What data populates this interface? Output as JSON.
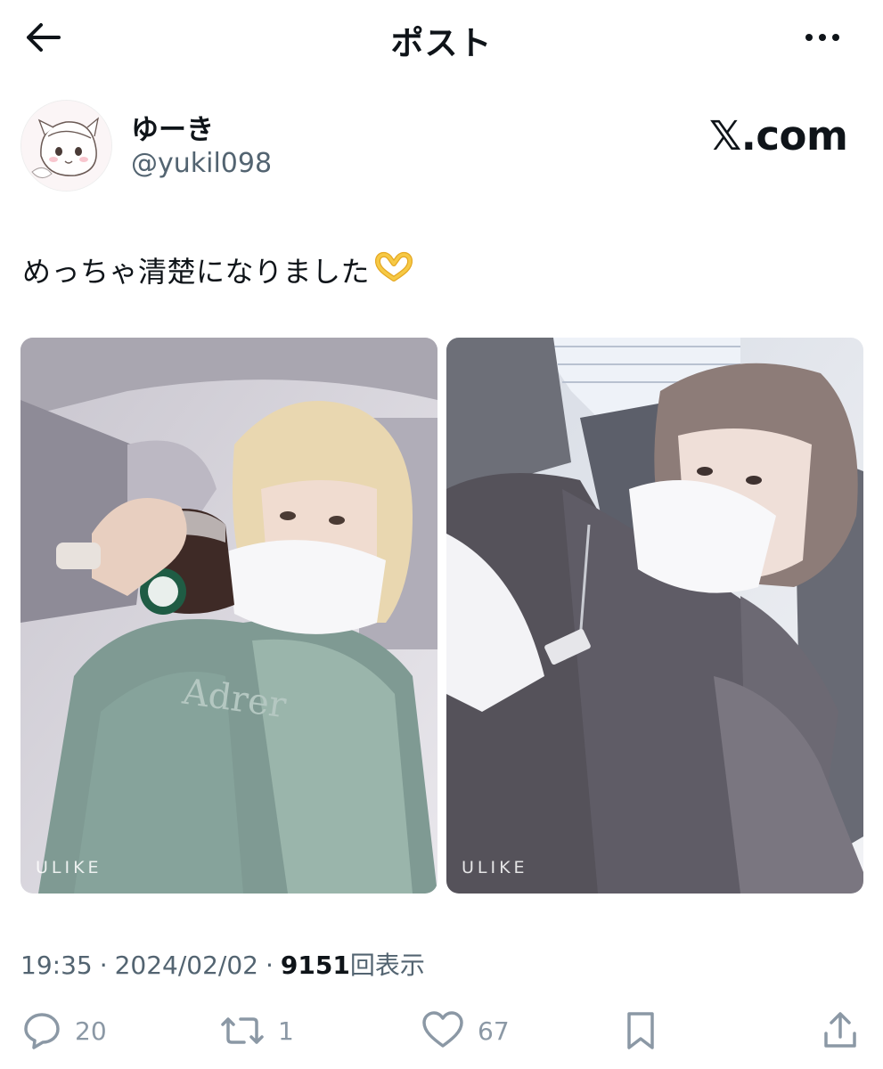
{
  "header": {
    "title": "ポスト"
  },
  "author": {
    "display_name": "ゆーき",
    "handle": "@yukil098"
  },
  "watermark": "𝕏.com",
  "post": {
    "text": "めっちゃ清楚になりました",
    "emoji": "heart-hands-emoji",
    "photo_watermark": "ULIKE"
  },
  "meta": {
    "time": "19:35",
    "date": "2024/02/02",
    "views": "9151",
    "views_label": "回表示",
    "separator": "·"
  },
  "actions": {
    "replies": "20",
    "reposts": "1",
    "likes": "67"
  },
  "colors": {
    "text": "#0f1419",
    "secondary": "#536471",
    "icon": "#8b98a5"
  }
}
